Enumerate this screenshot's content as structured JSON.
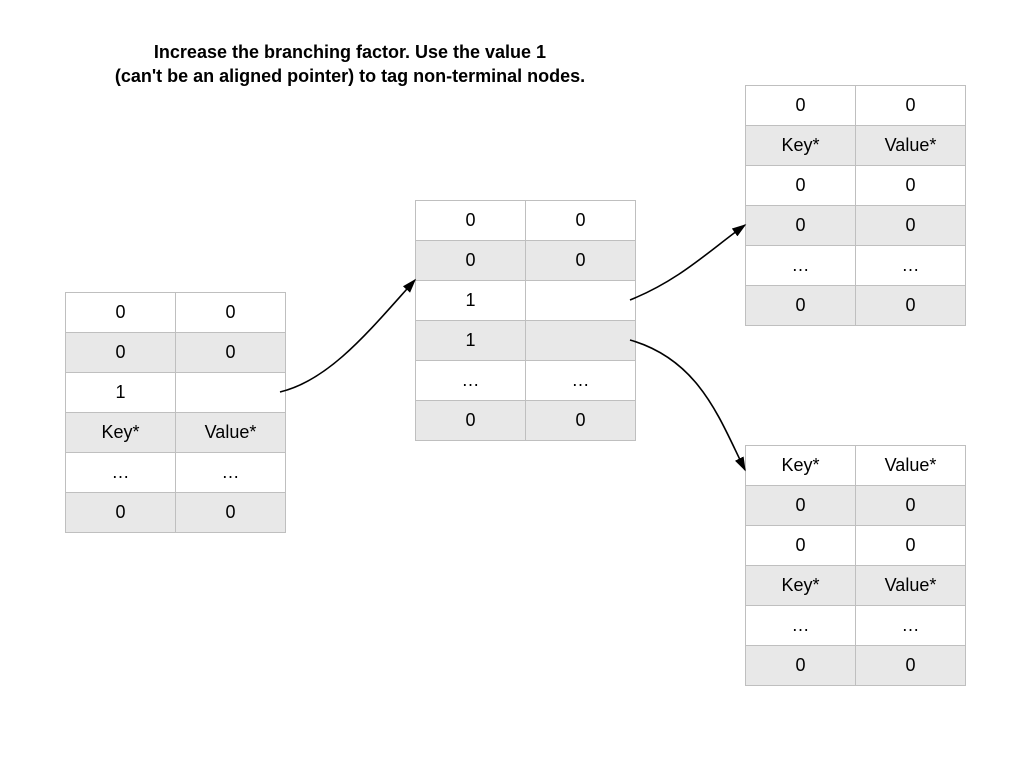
{
  "title_line1": "Increase the branching factor. Use the value 1",
  "title_line2": "(can't be an aligned pointer) to tag non-terminal nodes.",
  "tables": {
    "A": [
      [
        "0",
        "0"
      ],
      [
        "0",
        "0"
      ],
      [
        "1",
        ""
      ],
      [
        "Key*",
        "Value*"
      ],
      [
        "…",
        "…"
      ],
      [
        "0",
        "0"
      ]
    ],
    "B": [
      [
        "0",
        "0"
      ],
      [
        "0",
        "0"
      ],
      [
        "1",
        ""
      ],
      [
        "1",
        ""
      ],
      [
        "…",
        "…"
      ],
      [
        "0",
        "0"
      ]
    ],
    "C": [
      [
        "0",
        "0"
      ],
      [
        "Key*",
        "Value*"
      ],
      [
        "0",
        "0"
      ],
      [
        "0",
        "0"
      ],
      [
        "…",
        "…"
      ],
      [
        "0",
        "0"
      ]
    ],
    "D": [
      [
        "Key*",
        "Value*"
      ],
      [
        "0",
        "0"
      ],
      [
        "0",
        "0"
      ],
      [
        "Key*",
        "Value*"
      ],
      [
        "…",
        "…"
      ],
      [
        "0",
        "0"
      ]
    ]
  }
}
